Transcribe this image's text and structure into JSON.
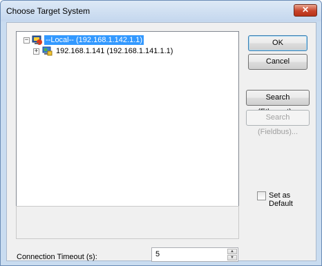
{
  "window": {
    "title": "Choose Target System",
    "close_glyph": "✕"
  },
  "tree": {
    "items": [
      {
        "label": "--Local--   (192.168.1.142.1.1)",
        "expander": "−",
        "selected": true
      },
      {
        "label": "192.168.1.141   (192.168.1.141.1.1)",
        "expander": "+",
        "selected": false
      }
    ]
  },
  "buttons": {
    "ok": "OK",
    "cancel": "Cancel",
    "search_ethernet": "Search (Ethernet)...",
    "search_fieldbus": "Search (Fieldbus)..."
  },
  "set_as_default": {
    "label": "Set as Default",
    "checked": false
  },
  "connection_timeout": {
    "label": "Connection Timeout (s):",
    "value": "5"
  },
  "colors": {
    "selection": "#3399ff",
    "title_bar": "#c9dcf0",
    "close_button": "#c7432a"
  },
  "icons": [
    "network-computer-icon",
    "remote-computer-icon",
    "close-icon",
    "spin-up-icon",
    "spin-down-icon"
  ]
}
